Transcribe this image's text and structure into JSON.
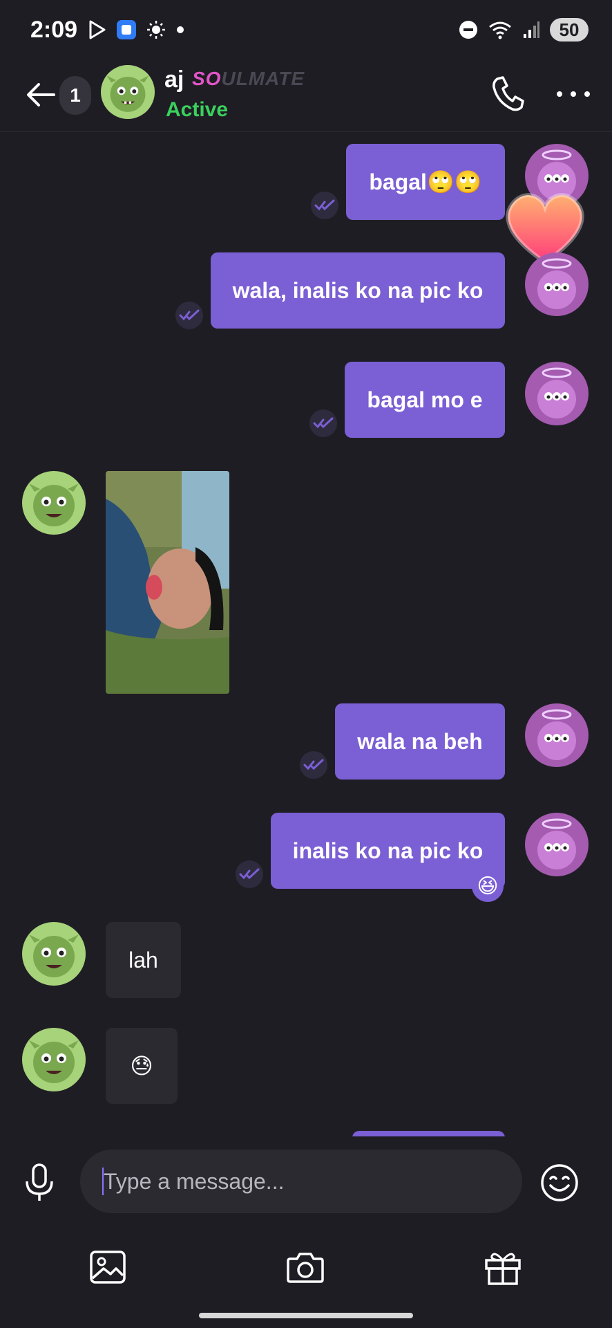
{
  "status_bar": {
    "time": "2:09",
    "battery": "50",
    "icons_left": [
      "play-store-icon",
      "app-notification-icon",
      "brightness-icon",
      "dot-icon"
    ],
    "icons_right": [
      "do-not-disturb-icon",
      "wifi-icon",
      "signal-icon",
      "battery-icon"
    ]
  },
  "header": {
    "unread_count": "1",
    "contact_name": "aj",
    "badge_prefix": "SO",
    "badge_suffix": "ULMATE",
    "status": "Active"
  },
  "messages": [
    {
      "direction": "out",
      "text": "bagal🙄🙄"
    },
    {
      "direction": "out",
      "text": "wala, inalis ko na pic ko"
    },
    {
      "direction": "out",
      "text": "bagal mo e"
    },
    {
      "direction": "in",
      "type": "photo"
    },
    {
      "direction": "out",
      "text": "wala na beh"
    },
    {
      "direction": "out",
      "text": "inalis ko na pic ko",
      "reaction": "😆"
    },
    {
      "direction": "in",
      "text": "lah"
    },
    {
      "direction": "in",
      "text": "😓"
    }
  ],
  "composer": {
    "placeholder": "Type a message..."
  },
  "colors": {
    "background": "#1f1d24",
    "outgoing_bubble": "#7b5fd4",
    "incoming_bubble": "#2c2a31",
    "active_status": "#39d15d",
    "badge_accent": "#e255c8"
  }
}
